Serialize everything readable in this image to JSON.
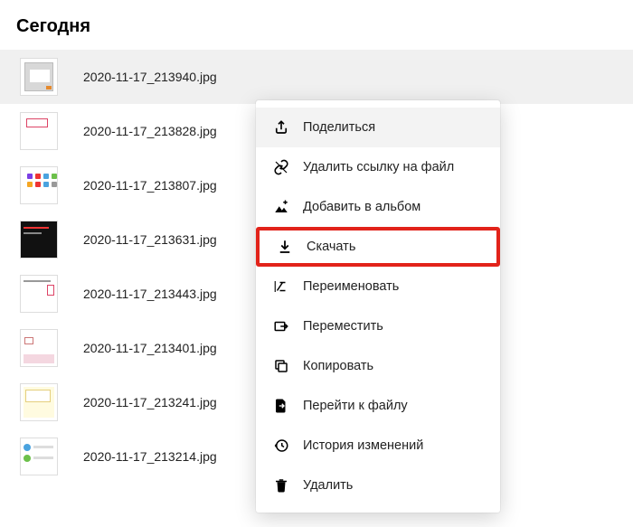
{
  "heading": "Сегодня",
  "files": [
    {
      "name": "2020-11-17_213940.jpg",
      "selected": true
    },
    {
      "name": "2020-11-17_213828.jpg",
      "selected": false
    },
    {
      "name": "2020-11-17_213807.jpg",
      "selected": false
    },
    {
      "name": "2020-11-17_213631.jpg",
      "selected": false
    },
    {
      "name": "2020-11-17_213443.jpg",
      "selected": false
    },
    {
      "name": "2020-11-17_213401.jpg",
      "selected": false
    },
    {
      "name": "2020-11-17_213241.jpg",
      "selected": false
    },
    {
      "name": "2020-11-17_213214.jpg",
      "selected": false
    }
  ],
  "menu": {
    "share": "Поделиться",
    "remove_link": "Удалить ссылку на файл",
    "add_album": "Добавить в альбом",
    "download": "Скачать",
    "rename": "Переименовать",
    "move": "Переместить",
    "copy": "Копировать",
    "goto_file": "Перейти к файлу",
    "history": "История изменений",
    "delete": "Удалить"
  },
  "colors": {
    "highlight": "#e2231a"
  }
}
